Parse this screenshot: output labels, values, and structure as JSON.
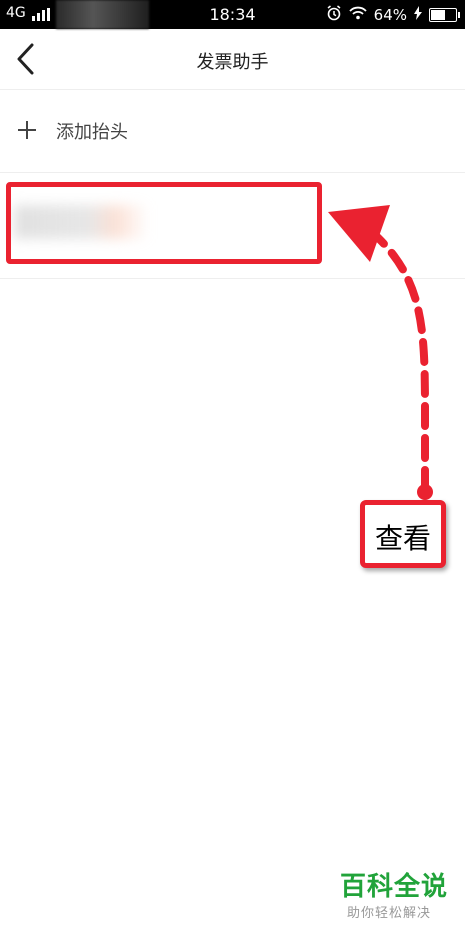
{
  "status_bar": {
    "carrier": "4G",
    "time": "18:34",
    "battery_text": "64%",
    "battery_level": 0.64,
    "icons": [
      "alarm-icon",
      "wifi-icon",
      "charging-icon"
    ]
  },
  "navbar": {
    "title": "发票助手",
    "back_icon": "chevron-left-icon"
  },
  "list": {
    "add_label": "添加抬头"
  },
  "annotation": {
    "callout_text": "查看",
    "color": "#ea2230"
  },
  "watermark": {
    "title": "百科全说",
    "subtitle": "助你轻松解决",
    "color": "#21a33a"
  }
}
